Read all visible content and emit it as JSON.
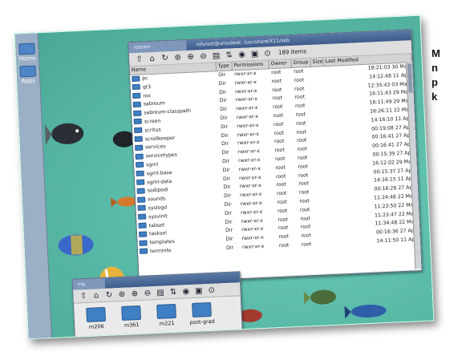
{
  "caption": {
    "lines": [
      "M",
      "n",
      "p",
      "k"
    ]
  },
  "desktop": {
    "panel": [
      {
        "label": "Home"
      },
      {
        "label": "Apps"
      }
    ]
  },
  "main_window": {
    "tabs": [
      "rostam",
      "rsfsroot@unixdesk: /usr/share/X11/xkb"
    ],
    "item_count": "189 items",
    "columns": [
      "Name",
      "Type",
      "Permissions",
      "Owner",
      "Group",
      "Size",
      "Last Modified"
    ],
    "rows": [
      {
        "name": "pc",
        "type": "Dir",
        "perm": "rwxr-xr-x",
        "owner": "root",
        "group": "root",
        "mod": "18:21:03 30 Mar"
      },
      {
        "name": "qt3",
        "type": "Dir",
        "perm": "rwxr-xr-x",
        "owner": "root",
        "group": "root",
        "mod": "14:12:48 11 Apr"
      },
      {
        "name": "rox",
        "type": "Dir",
        "perm": "rwxr-xr-x",
        "owner": "root",
        "group": "root",
        "mod": "12:35:43 03 May"
      },
      {
        "name": "sabreum",
        "type": "Dir",
        "perm": "rwxr-xr-x",
        "owner": "root",
        "group": "root",
        "mod": "16:11:43 29 Mar"
      },
      {
        "name": "sabreum-classpath",
        "type": "Dir",
        "perm": "rwxr-xr-x",
        "owner": "root",
        "group": "root",
        "mod": "16:11:49 29 Mar"
      },
      {
        "name": "screen",
        "type": "Dir",
        "perm": "rwxr-xr-x",
        "owner": "root",
        "group": "root",
        "mod": "16:26:11 22 Mar"
      },
      {
        "name": "scritus",
        "type": "Dir",
        "perm": "rwxr-xr-x",
        "owner": "root",
        "group": "root",
        "mod": "14:16:10 11 Apr"
      },
      {
        "name": "scrollkeeper",
        "type": "Dir",
        "perm": "rwxr-xr-x",
        "owner": "root",
        "group": "root",
        "mod": "00:19:08 27 Apr"
      },
      {
        "name": "services",
        "type": "Dir",
        "perm": "rwxr-xr-x",
        "owner": "root",
        "group": "root",
        "mod": "00:16:41 27 Apr"
      },
      {
        "name": "servicetypes",
        "type": "Dir",
        "perm": "rwxr-xr-x",
        "owner": "root",
        "group": "root",
        "mod": "00:16:41 27 Apr"
      },
      {
        "name": "sgml",
        "type": "Dir",
        "perm": "rwxr-xr-x",
        "owner": "root",
        "group": "root",
        "mod": "00:15:39 27 Apr"
      },
      {
        "name": "sgml-base",
        "type": "Dir",
        "perm": "rwxr-xr-x",
        "owner": "root",
        "group": "root",
        "mod": "16:12:02 29 Mar"
      },
      {
        "name": "sgml-data",
        "type": "Dir",
        "perm": "rwxr-xr-x",
        "owner": "root",
        "group": "root",
        "mod": "00:15:37 27 Apr"
      },
      {
        "name": "sodipodi",
        "type": "Dir",
        "perm": "rwxr-xr-x",
        "owner": "root",
        "group": "root",
        "mod": "14:16:15 11 Apr"
      },
      {
        "name": "sounds",
        "type": "Dir",
        "perm": "rwxr-xr-x",
        "owner": "root",
        "group": "root",
        "mod": "00:16:28 27 Apr"
      },
      {
        "name": "syslogd",
        "type": "Dir",
        "perm": "rwxr-xr-x",
        "owner": "root",
        "group": "root",
        "mod": "11:24:48 22 Mar"
      },
      {
        "name": "sysvinit",
        "type": "Dir",
        "perm": "rwxr-xr-x",
        "owner": "root",
        "group": "root",
        "mod": "11:23:50 22 Mar"
      },
      {
        "name": "tabset",
        "type": "Dir",
        "perm": "rwxr-xr-x",
        "owner": "root",
        "group": "root",
        "mod": "11:23:47 22 Mar"
      },
      {
        "name": "tasksel",
        "type": "Dir",
        "perm": "rwxr-xr-x",
        "owner": "root",
        "group": "root",
        "mod": "11:34:48 22 Mar"
      },
      {
        "name": "templates",
        "type": "Dir",
        "perm": "rwxr-xr-x",
        "owner": "root",
        "group": "root",
        "mod": "00:16:36 27 Apr"
      },
      {
        "name": "terminfo",
        "type": "Dir",
        "perm": "rwxr-xr-x",
        "owner": "root",
        "group": "root",
        "mod": "14:11:50 11 Apr"
      }
    ]
  },
  "second_window": {
    "title": "mp",
    "folders": [
      "m206",
      "m361",
      "m221",
      "post-grad"
    ]
  },
  "colors": {
    "desktop": "#5fbfae",
    "folder": "#3f7fc4",
    "titlebar": "#3d5c8a"
  }
}
